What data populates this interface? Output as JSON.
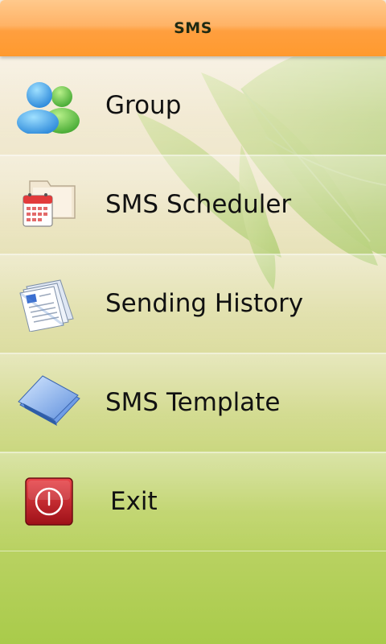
{
  "app": {
    "title": "SMS"
  },
  "menu": {
    "items": [
      {
        "label": "Group",
        "icon": "group-users-icon"
      },
      {
        "label": "SMS Scheduler",
        "icon": "calendar-folder-icon"
      },
      {
        "label": "Sending History",
        "icon": "documents-history-icon"
      },
      {
        "label": "SMS Template",
        "icon": "template-folder-icon"
      },
      {
        "label": "Exit",
        "icon": "power-icon"
      }
    ]
  },
  "colors": {
    "titlebar": "#ff9a2e",
    "background_top": "#f7eee0",
    "background_bottom": "#a9cb4a",
    "leaf": "#9ccc56"
  }
}
